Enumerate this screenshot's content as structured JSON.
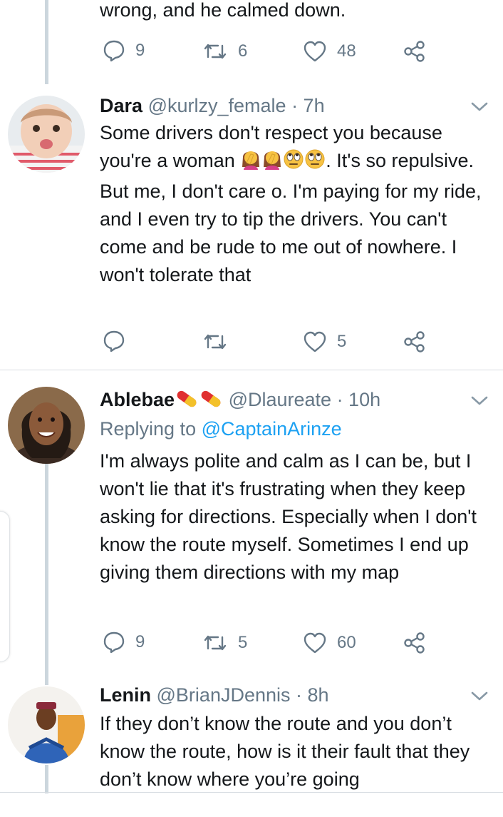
{
  "tweets": [
    {
      "text": "wrong, and he calmed down.",
      "stats": {
        "replies": "9",
        "retweets": "6",
        "likes": "48"
      }
    },
    {
      "name": "Dara",
      "handle": "@kurlzy_female",
      "time": "· 7h",
      "text_1": "Some drivers don't respect you because you're a woman",
      "text_2": ". It's so repulsive. But me, I don't care o. I'm paying for my ride, and I even try to tip the drivers. You can't come and be rude to me out of nowhere. I won't tolerate that",
      "emojis": [
        "woman-facepalming",
        "woman-facepalming",
        "face-with-rolling-eyes",
        "face-with-rolling-eyes"
      ],
      "stats": {
        "replies": "",
        "retweets": "",
        "likes": "5"
      }
    },
    {
      "name": "Ablebae",
      "name_emojis": [
        "pill",
        "pill"
      ],
      "handle": "@Dlaureate",
      "time": "· 10h",
      "replying_prefix": "Replying to",
      "replying_to": "@CaptainArinze",
      "text": "I'm always polite and calm as I can be, but I won't lie that it's frustrating when they keep asking for directions. Especially when I don't know the route myself. Sometimes I end up giving them directions with my map",
      "stats": {
        "replies": "9",
        "retweets": "5",
        "likes": "60"
      }
    },
    {
      "name": "Lenin",
      "handle": "@BrianJDennis",
      "time": "· 8h",
      "text": "If they don’t know the route and you don’t know the route, how is it their fault that they don’t know where you’re going"
    }
  ],
  "colors": {
    "text": "#14171a",
    "muted": "#657786",
    "link": "#1da1f2",
    "thread_line": "#ccd6dd"
  }
}
